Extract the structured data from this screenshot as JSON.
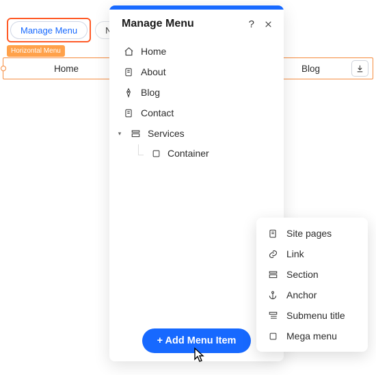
{
  "chips": {
    "manage_menu": "Manage Menu",
    "navigate_partial": "Na"
  },
  "horizontal_menu": {
    "badge": "Horizontal Menu",
    "items": {
      "home": "Home",
      "blog": "Blog"
    }
  },
  "panel": {
    "title": "Manage Menu",
    "items": [
      {
        "label": "Home"
      },
      {
        "label": "About"
      },
      {
        "label": "Blog"
      },
      {
        "label": "Contact"
      },
      {
        "label": "Services"
      }
    ],
    "sub_item": "Container",
    "add_button": "+ Add Menu Item"
  },
  "popover": {
    "items": [
      {
        "label": "Site pages"
      },
      {
        "label": "Link"
      },
      {
        "label": "Section"
      },
      {
        "label": "Anchor"
      },
      {
        "label": "Submenu title"
      },
      {
        "label": "Mega menu"
      }
    ]
  }
}
